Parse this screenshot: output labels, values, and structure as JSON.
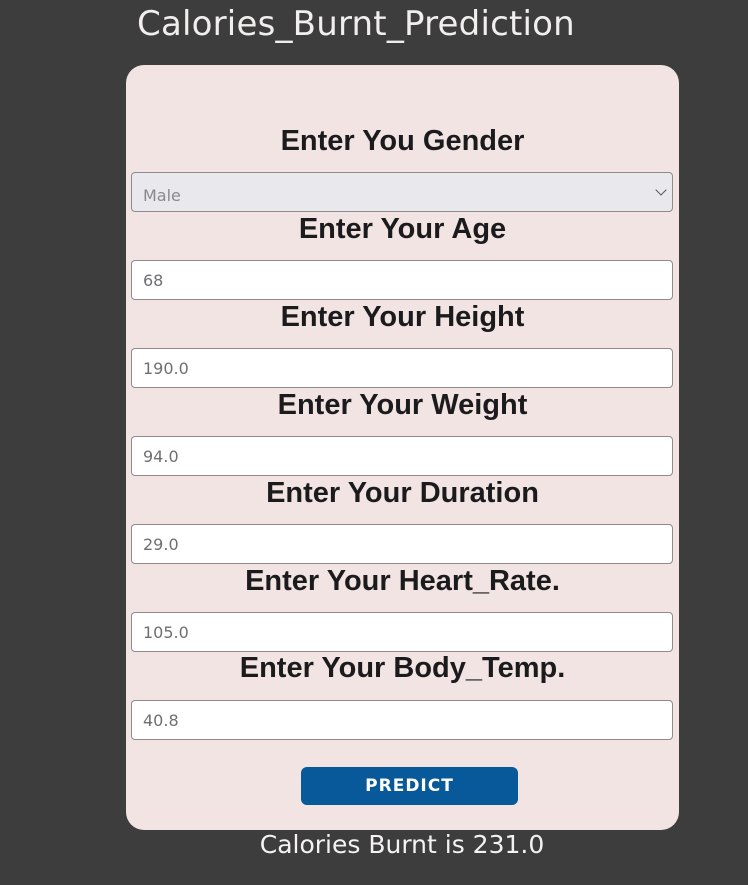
{
  "header": {
    "title": "Calories_Burnt_Prediction"
  },
  "form": {
    "gender": {
      "label": "Enter You Gender",
      "selected": "Male"
    },
    "age": {
      "label": "Enter Your Age",
      "value": "68"
    },
    "height": {
      "label": "Enter Your Height",
      "value": "190.0"
    },
    "weight": {
      "label": "Enter Your Weight",
      "value": "94.0"
    },
    "duration": {
      "label": "Enter Your Duration",
      "value": "29.0"
    },
    "heart_rate": {
      "label": "Enter Your Heart_Rate.",
      "value": "105.0"
    },
    "body_temp": {
      "label": "Enter Your Body_Temp.",
      "value": "40.8"
    },
    "predict_label": "PREDICT"
  },
  "result": {
    "text": "Calories Burnt is 231.0"
  },
  "colors": {
    "background": "#3e3d3e",
    "card": "#f1e4e3",
    "button": "#07599a"
  }
}
